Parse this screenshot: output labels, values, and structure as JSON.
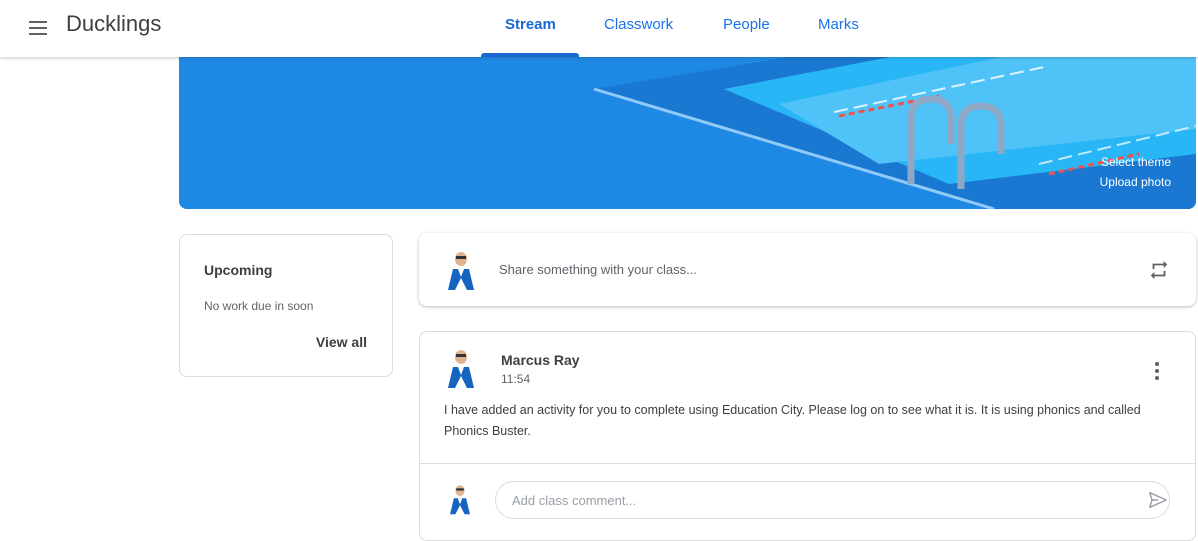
{
  "header": {
    "title": "Ducklings",
    "tabs": [
      {
        "label": "Stream",
        "active": true
      },
      {
        "label": "Classwork",
        "active": false
      },
      {
        "label": "People",
        "active": false
      },
      {
        "label": "Marks",
        "active": false
      }
    ]
  },
  "banner": {
    "select_theme": "Select theme",
    "upload_photo": "Upload photo"
  },
  "upcoming": {
    "title": "Upcoming",
    "empty_text": "No work due in soon",
    "view_all": "View all"
  },
  "share": {
    "prompt": "Share something with your class..."
  },
  "post": {
    "author": "Marcus Ray",
    "time": "11:54",
    "body": "I have added an activity for you to complete using Education City. Please log on to see what it is. It is using phonics and called Phonics Buster.",
    "comment_placeholder": "Add class comment..."
  },
  "colors": {
    "accent": "#1967d2",
    "banner": "#1e88e5"
  },
  "icons": [
    "menu-icon",
    "repost-icon",
    "more-vert-icon",
    "send-icon",
    "avatar"
  ]
}
